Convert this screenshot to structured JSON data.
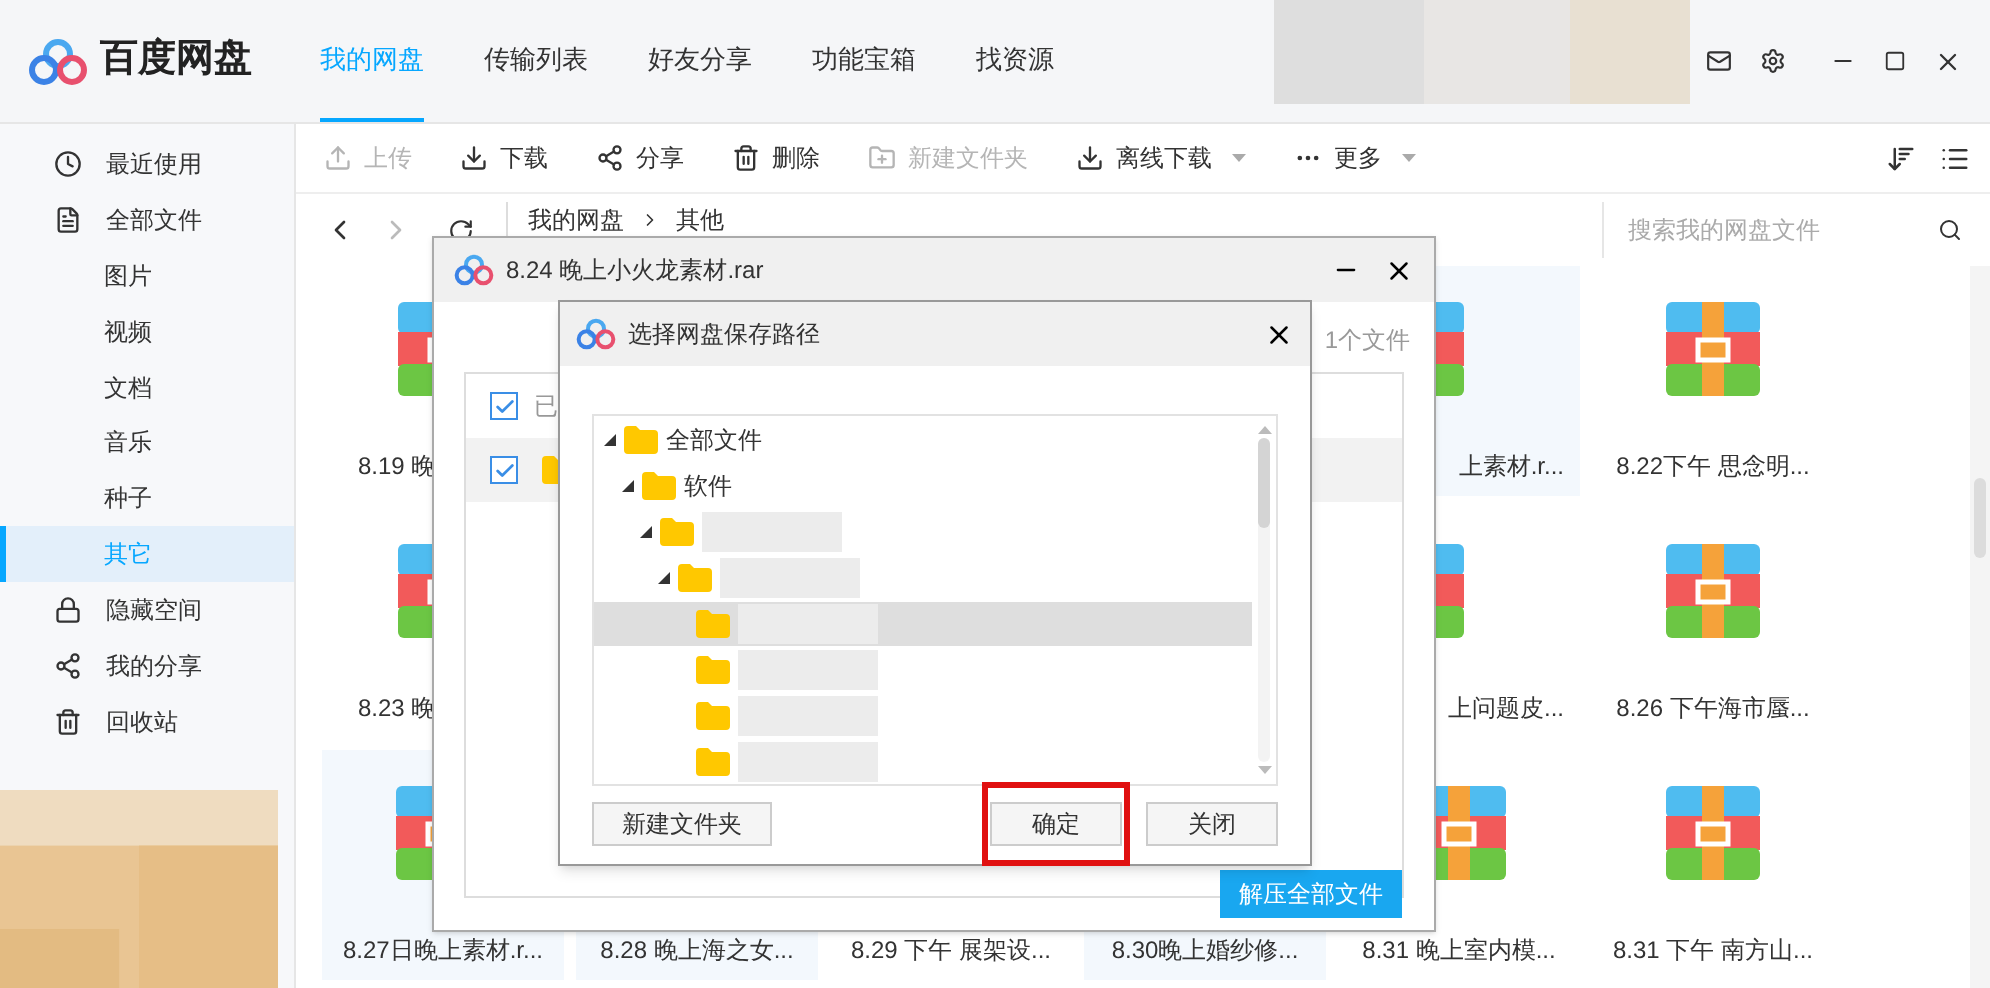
{
  "app": {
    "name": "百度网盘"
  },
  "nav_tabs": [
    {
      "label": "我的网盘",
      "selected": true
    },
    {
      "label": "传输列表",
      "selected": false
    },
    {
      "label": "好友分享",
      "selected": false
    },
    {
      "label": "功能宝箱",
      "selected": false
    },
    {
      "label": "找资源",
      "selected": false
    }
  ],
  "sidebar": {
    "items": [
      {
        "label": "最近使用",
        "kind": "clock",
        "selected": false,
        "sub": false
      },
      {
        "label": "全部文件",
        "kind": "file",
        "selected": false,
        "sub": false
      },
      {
        "label": "图片",
        "kind": "none",
        "selected": false,
        "sub": true
      },
      {
        "label": "视频",
        "kind": "none",
        "selected": false,
        "sub": true
      },
      {
        "label": "文档",
        "kind": "none",
        "selected": false,
        "sub": true
      },
      {
        "label": "音乐",
        "kind": "none",
        "selected": false,
        "sub": true
      },
      {
        "label": "种子",
        "kind": "none",
        "selected": false,
        "sub": true
      },
      {
        "label": "其它",
        "kind": "none",
        "selected": true,
        "sub": true
      },
      {
        "label": "隐藏空间",
        "kind": "lock",
        "selected": false,
        "sub": false
      },
      {
        "label": "我的分享",
        "kind": "share",
        "selected": false,
        "sub": false
      },
      {
        "label": "回收站",
        "kind": "trash",
        "selected": false,
        "sub": false
      }
    ]
  },
  "toolbar": [
    {
      "label": "上传",
      "kind": "upload",
      "disabled": true,
      "menu": false
    },
    {
      "label": "下载",
      "kind": "download",
      "disabled": false,
      "menu": false
    },
    {
      "label": "分享",
      "kind": "share",
      "disabled": false,
      "menu": false
    },
    {
      "label": "删除",
      "kind": "trash",
      "disabled": false,
      "menu": false
    },
    {
      "label": "新建文件夹",
      "kind": "folder",
      "disabled": true,
      "menu": false
    },
    {
      "label": "离线下载",
      "kind": "download",
      "disabled": false,
      "menu": true
    },
    {
      "label": "更多",
      "kind": "more",
      "disabled": false,
      "menu": true
    }
  ],
  "breadcrumb": [
    "我的网盘",
    "其他"
  ],
  "search": {
    "placeholder": "搜索我的网盘文件"
  },
  "files": [
    [
      {
        "kind": "partial_left",
        "label": "8.19 晚",
        "highlighted": false
      },
      {
        "kind": "covered"
      },
      {
        "kind": "covered"
      },
      {
        "kind": "covered"
      },
      {
        "kind": "partial_right",
        "label": "上素材.r...",
        "highlighted": true
      },
      {
        "kind": "full",
        "label": "8.22下午 思念明...",
        "highlighted": false
      }
    ],
    [
      {
        "kind": "partial_left",
        "label": "8.23 晚",
        "highlighted": false
      },
      {
        "kind": "covered"
      },
      {
        "kind": "covered"
      },
      {
        "kind": "covered"
      },
      {
        "kind": "partial_right",
        "label": "上问题皮...",
        "highlighted": false
      },
      {
        "kind": "full",
        "label": "8.26 下午海市蜃...",
        "highlighted": false
      }
    ],
    [
      {
        "kind": "full",
        "label": "8.27日晚上素材.r...",
        "highlighted": true
      },
      {
        "kind": "label_only",
        "label": "8.28 晚上海之女...",
        "highlighted": true
      },
      {
        "kind": "label_only",
        "label": "8.29 下午 展架设...",
        "highlighted": false
      },
      {
        "kind": "label_only",
        "label": "8.30晚上婚纱修...",
        "highlighted": true
      },
      {
        "kind": "full",
        "label": "8.31 晚上室内模...",
        "highlighted": false
      },
      {
        "kind": "full",
        "label": "8.31 下午 南方山...",
        "highlighted": false
      }
    ]
  ],
  "archive_dialog": {
    "title": "8.24 晚上小火龙素材.rar",
    "count": "1个文件",
    "header": {
      "label": "已",
      "checked": true
    },
    "rows": [
      {
        "checked": true
      }
    ],
    "extract_button": "解压全部文件"
  },
  "save_dialog": {
    "title": "选择网盘保存路径",
    "tree": [
      {
        "label": "全部文件",
        "expanded": true,
        "selected": false,
        "children": [
          {
            "label": "软件",
            "expanded": true,
            "selected": false,
            "children": [
              {
                "expanded": true,
                "selected": false,
                "children": [
                  {
                    "expanded": true,
                    "selected": false,
                    "children": [
                      {
                        "expanded": false,
                        "selected": true
                      },
                      {
                        "expanded": false,
                        "selected": false
                      },
                      {
                        "expanded": false,
                        "selected": false
                      },
                      {
                        "expanded": false,
                        "selected": false
                      }
                    ]
                  }
                ]
              }
            ]
          }
        ]
      }
    ],
    "buttons": [
      {
        "label": "新建文件夹",
        "highlighted": false
      },
      {
        "label": "确定",
        "highlighted": true
      },
      {
        "label": "关闭",
        "highlighted": false
      }
    ]
  }
}
